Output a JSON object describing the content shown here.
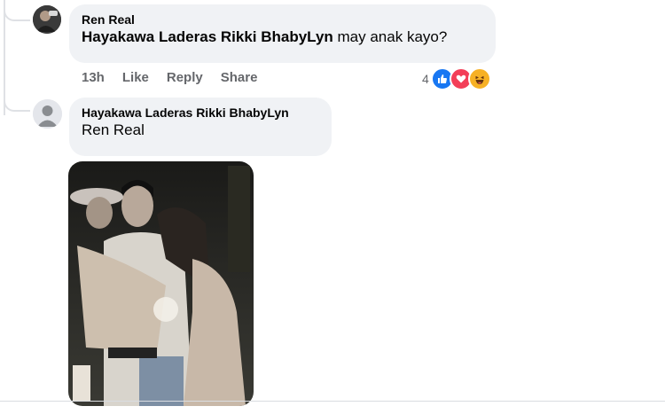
{
  "comment1": {
    "author": "Ren Real",
    "mention": "Hayakawa Laderas Rikki BhabyLyn",
    "text": "may anak kayo?",
    "time": "13h",
    "like": "Like",
    "reply": "Reply",
    "share": "Share",
    "reaction_count": "4",
    "reactions": [
      "like-icon",
      "love-icon",
      "haha-icon"
    ]
  },
  "comment2": {
    "author": "Hayakawa Laderas Rikki BhabyLyn",
    "text": "Ren Real"
  },
  "colors": {
    "bubble": "#f0f2f5",
    "like": "#1877f2",
    "love": "#f33e58",
    "haha": "#f7b125"
  }
}
